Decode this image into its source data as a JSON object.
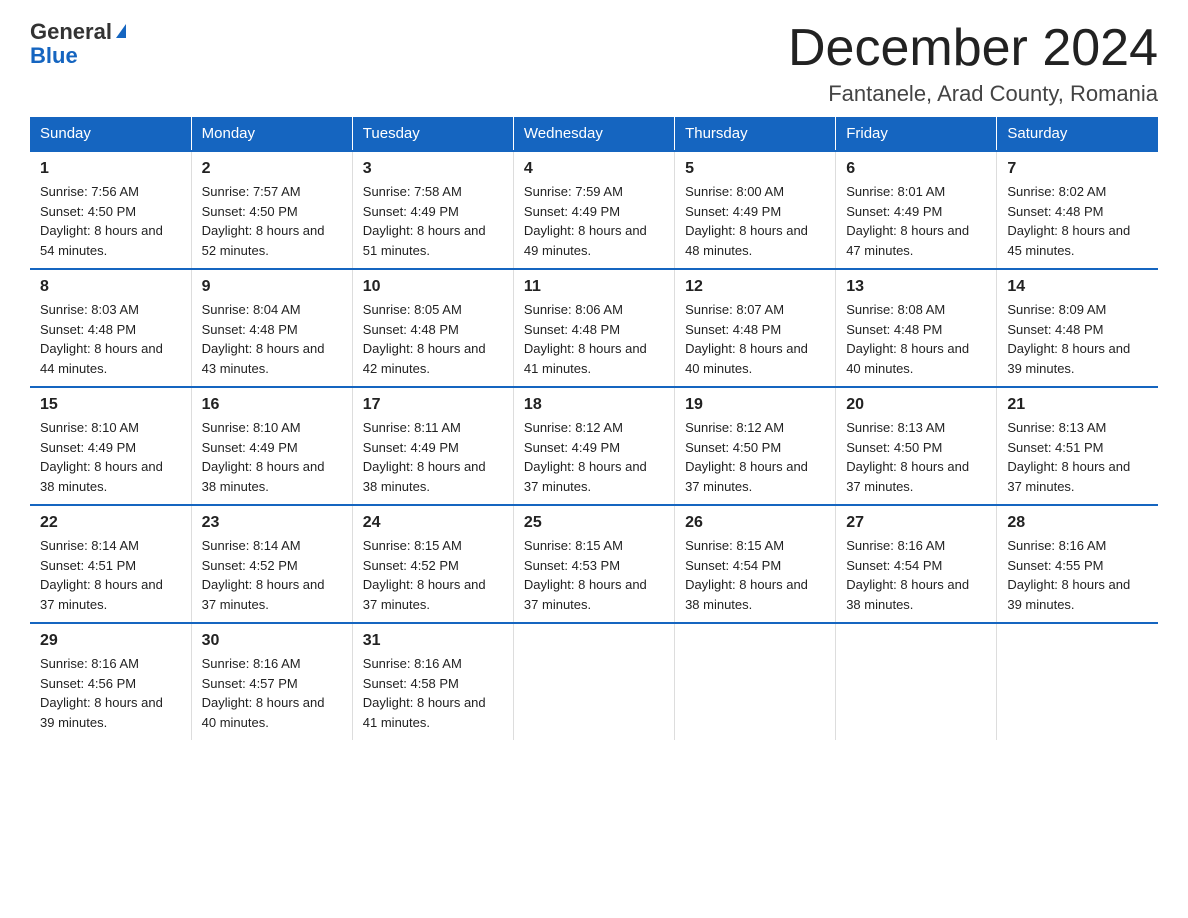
{
  "header": {
    "logo_line1": "General",
    "logo_line2": "Blue",
    "month_title": "December 2024",
    "location": "Fantanele, Arad County, Romania"
  },
  "days_of_week": [
    "Sunday",
    "Monday",
    "Tuesday",
    "Wednesday",
    "Thursday",
    "Friday",
    "Saturday"
  ],
  "weeks": [
    [
      {
        "num": "1",
        "sunrise": "7:56 AM",
        "sunset": "4:50 PM",
        "daylight": "8 hours and 54 minutes."
      },
      {
        "num": "2",
        "sunrise": "7:57 AM",
        "sunset": "4:50 PM",
        "daylight": "8 hours and 52 minutes."
      },
      {
        "num": "3",
        "sunrise": "7:58 AM",
        "sunset": "4:49 PM",
        "daylight": "8 hours and 51 minutes."
      },
      {
        "num": "4",
        "sunrise": "7:59 AM",
        "sunset": "4:49 PM",
        "daylight": "8 hours and 49 minutes."
      },
      {
        "num": "5",
        "sunrise": "8:00 AM",
        "sunset": "4:49 PM",
        "daylight": "8 hours and 48 minutes."
      },
      {
        "num": "6",
        "sunrise": "8:01 AM",
        "sunset": "4:49 PM",
        "daylight": "8 hours and 47 minutes."
      },
      {
        "num": "7",
        "sunrise": "8:02 AM",
        "sunset": "4:48 PM",
        "daylight": "8 hours and 45 minutes."
      }
    ],
    [
      {
        "num": "8",
        "sunrise": "8:03 AM",
        "sunset": "4:48 PM",
        "daylight": "8 hours and 44 minutes."
      },
      {
        "num": "9",
        "sunrise": "8:04 AM",
        "sunset": "4:48 PM",
        "daylight": "8 hours and 43 minutes."
      },
      {
        "num": "10",
        "sunrise": "8:05 AM",
        "sunset": "4:48 PM",
        "daylight": "8 hours and 42 minutes."
      },
      {
        "num": "11",
        "sunrise": "8:06 AM",
        "sunset": "4:48 PM",
        "daylight": "8 hours and 41 minutes."
      },
      {
        "num": "12",
        "sunrise": "8:07 AM",
        "sunset": "4:48 PM",
        "daylight": "8 hours and 40 minutes."
      },
      {
        "num": "13",
        "sunrise": "8:08 AM",
        "sunset": "4:48 PM",
        "daylight": "8 hours and 40 minutes."
      },
      {
        "num": "14",
        "sunrise": "8:09 AM",
        "sunset": "4:48 PM",
        "daylight": "8 hours and 39 minutes."
      }
    ],
    [
      {
        "num": "15",
        "sunrise": "8:10 AM",
        "sunset": "4:49 PM",
        "daylight": "8 hours and 38 minutes."
      },
      {
        "num": "16",
        "sunrise": "8:10 AM",
        "sunset": "4:49 PM",
        "daylight": "8 hours and 38 minutes."
      },
      {
        "num": "17",
        "sunrise": "8:11 AM",
        "sunset": "4:49 PM",
        "daylight": "8 hours and 38 minutes."
      },
      {
        "num": "18",
        "sunrise": "8:12 AM",
        "sunset": "4:49 PM",
        "daylight": "8 hours and 37 minutes."
      },
      {
        "num": "19",
        "sunrise": "8:12 AM",
        "sunset": "4:50 PM",
        "daylight": "8 hours and 37 minutes."
      },
      {
        "num": "20",
        "sunrise": "8:13 AM",
        "sunset": "4:50 PM",
        "daylight": "8 hours and 37 minutes."
      },
      {
        "num": "21",
        "sunrise": "8:13 AM",
        "sunset": "4:51 PM",
        "daylight": "8 hours and 37 minutes."
      }
    ],
    [
      {
        "num": "22",
        "sunrise": "8:14 AM",
        "sunset": "4:51 PM",
        "daylight": "8 hours and 37 minutes."
      },
      {
        "num": "23",
        "sunrise": "8:14 AM",
        "sunset": "4:52 PM",
        "daylight": "8 hours and 37 minutes."
      },
      {
        "num": "24",
        "sunrise": "8:15 AM",
        "sunset": "4:52 PM",
        "daylight": "8 hours and 37 minutes."
      },
      {
        "num": "25",
        "sunrise": "8:15 AM",
        "sunset": "4:53 PM",
        "daylight": "8 hours and 37 minutes."
      },
      {
        "num": "26",
        "sunrise": "8:15 AM",
        "sunset": "4:54 PM",
        "daylight": "8 hours and 38 minutes."
      },
      {
        "num": "27",
        "sunrise": "8:16 AM",
        "sunset": "4:54 PM",
        "daylight": "8 hours and 38 minutes."
      },
      {
        "num": "28",
        "sunrise": "8:16 AM",
        "sunset": "4:55 PM",
        "daylight": "8 hours and 39 minutes."
      }
    ],
    [
      {
        "num": "29",
        "sunrise": "8:16 AM",
        "sunset": "4:56 PM",
        "daylight": "8 hours and 39 minutes."
      },
      {
        "num": "30",
        "sunrise": "8:16 AM",
        "sunset": "4:57 PM",
        "daylight": "8 hours and 40 minutes."
      },
      {
        "num": "31",
        "sunrise": "8:16 AM",
        "sunset": "4:58 PM",
        "daylight": "8 hours and 41 minutes."
      },
      null,
      null,
      null,
      null
    ]
  ]
}
